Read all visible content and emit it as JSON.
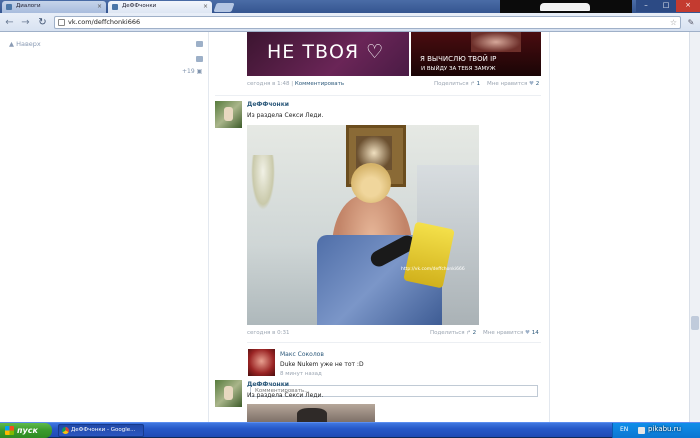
{
  "browser": {
    "tabs": [
      {
        "label": "Диалоги"
      },
      {
        "label": "ДеФФчонки"
      }
    ],
    "url": "vk.com/deffchonki666"
  },
  "sidebar": {
    "up_label": "Наверх",
    "counter": "+19"
  },
  "post1": {
    "image_text": "НЕ ТВОЯ ♡",
    "image2_line1": "Я ВЫЧИСЛЮ ТВОЙ IP",
    "image2_line2": "И ВЫЙДУ ЗА ТЕБЯ ЗАМУЖ",
    "time": "сегодня в 1:48",
    "separator": "|",
    "comment_link": "Комментировать",
    "share_label": "Поделиться",
    "share_count": "1",
    "like_label": "Мне нравится",
    "like_count": "2"
  },
  "post2": {
    "author": "ДеФФчонки",
    "text": "Из раздела Секси Леди.",
    "watermark": "http://vk.com/deffchonki666",
    "time": "сегодня в 0:31",
    "share_label": "Поделиться",
    "share_count": "2",
    "like_label": "Мне нравится",
    "like_count": "14",
    "comment": {
      "author": "Макс Соколов",
      "text": "Duke Nukem уже не тот :D",
      "time": "8 минут назад"
    },
    "comment_placeholder": "Комментировать..."
  },
  "post3": {
    "author": "ДеФФчонки",
    "text": "Из раздела Секси Леди."
  },
  "taskbar": {
    "start_label": "пуск",
    "window_label": "ДеФФчонки - Google...",
    "lang": "EN",
    "watermark": "pikabu.ru"
  }
}
